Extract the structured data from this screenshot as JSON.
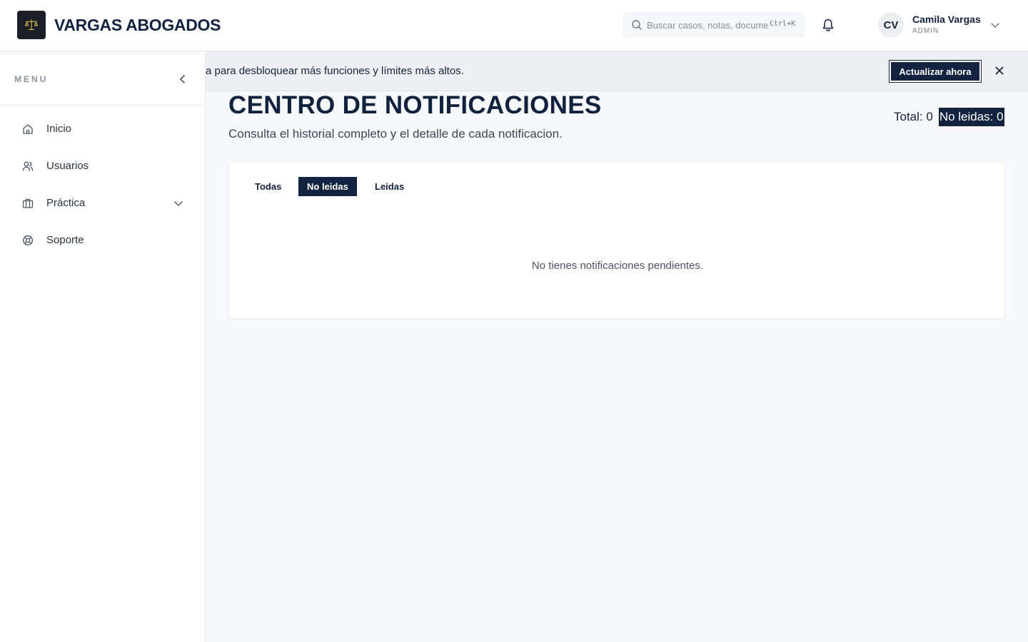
{
  "brand": {
    "name": "VARGAS ABOGADOS"
  },
  "header": {
    "search_placeholder": "Buscar casos, notas, documentos",
    "search_shortcut": "Ctrl+K",
    "user": {
      "initials": "CV",
      "name": "Camila Vargas",
      "role": "ADMIN"
    }
  },
  "sidebar": {
    "title": "MENU",
    "items": [
      {
        "label": "Inicio",
        "icon": "home-icon"
      },
      {
        "label": "Usuarios",
        "icon": "users-icon"
      },
      {
        "label": "Práctica",
        "icon": "briefcase-icon",
        "expandable": true
      },
      {
        "label": "Soporte",
        "icon": "lifebuoy-icon"
      }
    ]
  },
  "banner": {
    "text": "a para desbloquear más funciones y límites más altos.",
    "button": "Actualizar ahora"
  },
  "main": {
    "title": "CENTRO DE NOTIFICACIONES",
    "subtitle": "Consulta el historial completo y el detalle de cada notificacion.",
    "total_label": "Total: 0",
    "unread_label": "No leidas: 0",
    "tabs": [
      {
        "label": "Todas",
        "active": false
      },
      {
        "label": "No leidas",
        "active": true
      },
      {
        "label": "Leidas",
        "active": false
      }
    ],
    "empty_message": "No tienes notificaciones pendientes."
  },
  "colors": {
    "primary": "#12233f",
    "background": "#f7f8fa",
    "surface": "#ffffff"
  }
}
